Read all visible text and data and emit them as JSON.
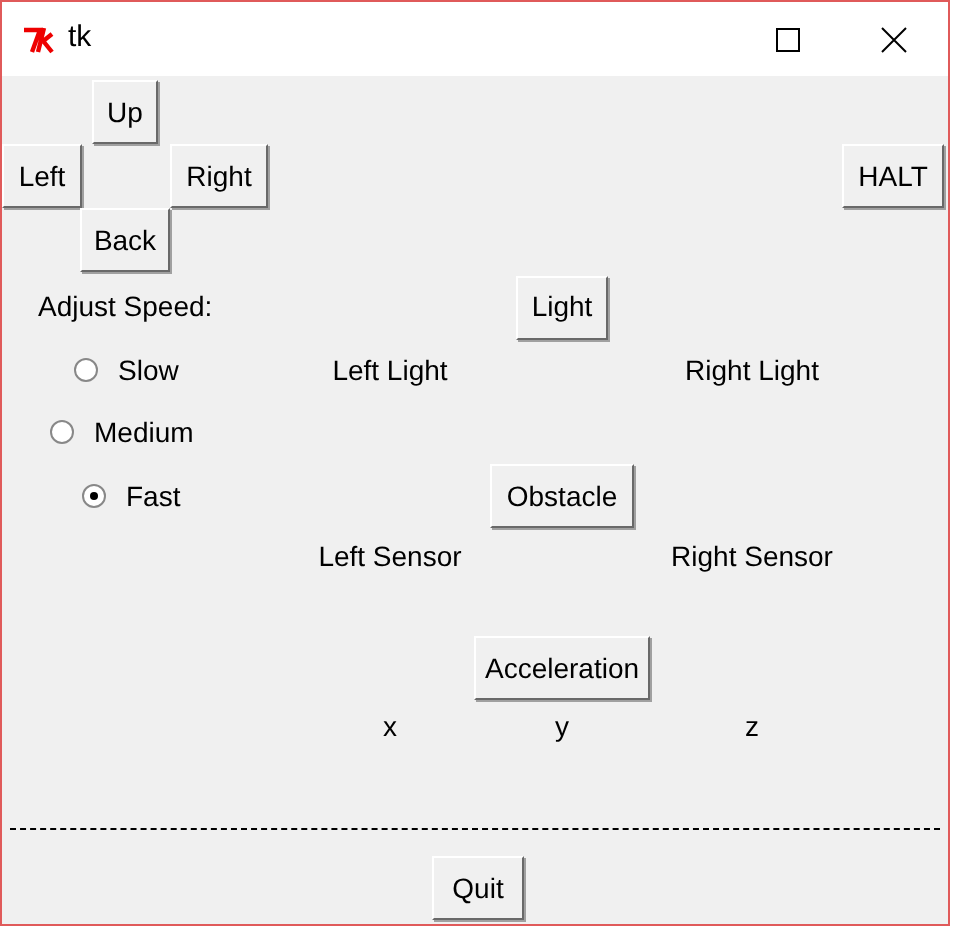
{
  "window": {
    "title": "tk"
  },
  "direction_buttons": [
    {
      "label": "Up"
    },
    {
      "label": "Left"
    },
    {
      "label": "Right"
    },
    {
      "label": "Back"
    }
  ],
  "halt_button": "HALT",
  "speed": {
    "label": "Adjust Speed:",
    "options": [
      {
        "label": "Slow",
        "selected": false
      },
      {
        "label": "Medium",
        "selected": false
      },
      {
        "label": "Fast",
        "selected": true
      }
    ]
  },
  "light": {
    "button": "Light",
    "left": "Left Light",
    "right": "Right Light"
  },
  "obstacle": {
    "button": "Obstacle",
    "left": "Left Sensor",
    "right": "Right Sensor"
  },
  "acceleration": {
    "button": "Acceleration",
    "axes": [
      "x",
      "y",
      "z"
    ]
  },
  "quit_button": "Quit"
}
